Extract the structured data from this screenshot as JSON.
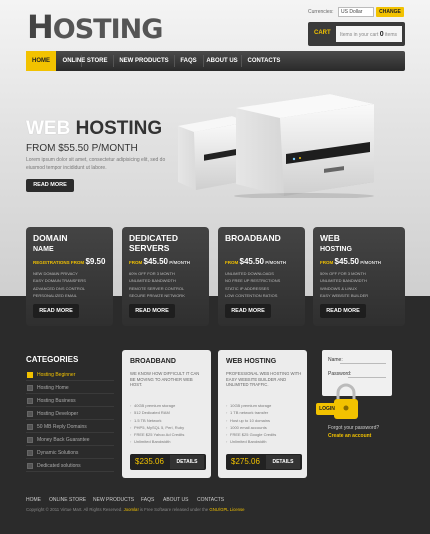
{
  "header": {
    "logo_first": "H",
    "logo_rest": "OSTING",
    "currency_label": "Currencies:",
    "currency_value": "US Dollar",
    "change_label": "CHANGE",
    "cart_label": "CART",
    "cart_text_before": "Items in your cart",
    "cart_count": "0",
    "cart_text_after": "items"
  },
  "nav": {
    "items": [
      "HOME",
      "ONLINE STORE",
      "NEW PRODUCTS",
      "FAQS",
      "ABOUT US",
      "CONTACTS"
    ]
  },
  "hero": {
    "title_light": "WEB",
    "title_dark": "HOSTING",
    "price": "FROM $55.50 P/MONTH",
    "text": "Lorem ipsum dolor sit amet, consectetur adipisicing elit, sed do eiusmod tempor incididunt ut labore.",
    "button": "READ MORE"
  },
  "plans": [
    {
      "title_line1": "DOMAIN",
      "title_line2": "NAME",
      "price_prefix": "REGISTRATIONS FROM",
      "price": "$9.50",
      "per": "",
      "features": [
        "NEW DOMAIN PRIVACY",
        "EASY DOMAIN TRANSFERS",
        "ADVANCED DNS CONTROL",
        "PERSONALIZED EMAIL"
      ],
      "button": "READ MORE"
    },
    {
      "title_line1": "DEDICATED",
      "title_line2": "SERVERS",
      "price_prefix": "FROM",
      "price": "$45.50",
      "per": "P/MONTH",
      "features": [
        "60% OFF FOR 3 MONTH",
        "UNLIMITED BANDWIDTH",
        "REMOTE SERVER CONTROL",
        "SECURE PRIVATE NETWORK"
      ],
      "button": "READ MORE"
    },
    {
      "title_line1": "BROADBAND",
      "title_line2": "",
      "price_prefix": "FROM",
      "price": "$45.50",
      "per": "P/MONTH",
      "features": [
        "UNLIMITED DOWNLOADS",
        "NO FREE UP RESTRICTIONS",
        "STATIC IP ADDRESSES",
        "LOW CONTENTION RATIOS"
      ],
      "button": "READ MORE"
    },
    {
      "title_line1": "WEB",
      "title_line2": "HOSTING",
      "price_prefix": "FROM",
      "price": "$45.50",
      "per": "P/MONTH",
      "features": [
        "50% OFF FOR 3 MONTH",
        "UNLIMITED BANDWIDTH",
        "WINDOWS & LINUX",
        "EASY WEBSITE BUILDER"
      ],
      "button": "READ MORE"
    }
  ],
  "categories": {
    "heading": "CATEGORIES",
    "items": [
      "Hosting Beginner",
      "Hosting Home",
      "Hosting Business",
      "Hosting Developer",
      "50 MB Reply Domains",
      "Money Back Guarantee",
      "Dynamic Solutions",
      "Dedicated solutions"
    ]
  },
  "cards": [
    {
      "title": "BROADBAND",
      "sub": "WE KNOW HOW DIFFICULT IT CAN BE MOVING TO ANOTHER WEB HOST.",
      "list": [
        "40GB premium storage",
        "512 Dedicated RAM",
        "1.5 TB Network",
        "PHP5, MySQL 5, Perl, Ruby",
        "FREE $25 Yahoo Ad Credits",
        "Unlimited Bandwidth"
      ],
      "price": "$235.06",
      "button": "DETAILS"
    },
    {
      "title": "WEB HOSTING",
      "sub": "PROFESSIONAL WEB HOSTING WITH EASY WEBSITE BUILDER AND UNLIMITED TRAFFIC.",
      "list": [
        "10GB premium storage",
        "1 TB network transfer",
        "Host up to 10 domains",
        "1000 email accounts",
        "FREE $25 Google Credits",
        "Unlimited Bandwidth"
      ],
      "price": "$275.06",
      "button": "DETAILS"
    }
  ],
  "login": {
    "name_label": "Name:",
    "password_label": "Password:",
    "button": "LOGIN",
    "forgot": "Forgot your password?",
    "create": "Create an account"
  },
  "footer": {
    "links": [
      "HOME",
      "ONLINE STORE",
      "NEW PRODUCTS",
      "FAQS",
      "ABOUT US",
      "CONTACTS"
    ],
    "copy_pre": "Copyright © 2011 Virtue Mart. All Rights Reserved.",
    "copy_joomla": "Joomla!",
    "copy_mid": "is Free Software released under the",
    "copy_license": "GNU/GPL License"
  },
  "colors": {
    "accent": "#f2c200",
    "dark": "#2b2b2b"
  }
}
